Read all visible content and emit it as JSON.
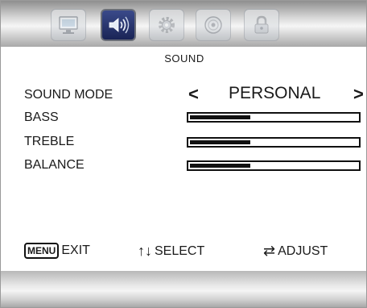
{
  "tabs": [
    {
      "name": "picture",
      "icon": "monitor-icon",
      "active": false
    },
    {
      "name": "sound",
      "icon": "speaker-icon",
      "active": true
    },
    {
      "name": "setup",
      "icon": "gear-icon",
      "active": false
    },
    {
      "name": "channel",
      "icon": "disc-icon",
      "active": false
    },
    {
      "name": "lock",
      "icon": "lock-icon",
      "active": false
    }
  ],
  "menu": {
    "title": "SOUND",
    "sound_mode_label": "SOUND MODE",
    "sound_mode_value": "PERSONAL",
    "prev_arrow": "<",
    "next_arrow": ">",
    "bass_label": "BASS",
    "treble_label": "TREBLE",
    "balance_label": "BALANCE",
    "bass_level": 0.36,
    "treble_level": 0.36,
    "balance_level": 0.36
  },
  "footer": {
    "menu_key": "MENU",
    "exit_label": "EXIT",
    "select_glyph": "↑↓",
    "select_label": "SELECT",
    "adjust_glyph": "⇄",
    "adjust_label": "ADJUST"
  },
  "colors": {
    "active_tab": "#1a2456",
    "bar_fill": "#111111"
  }
}
